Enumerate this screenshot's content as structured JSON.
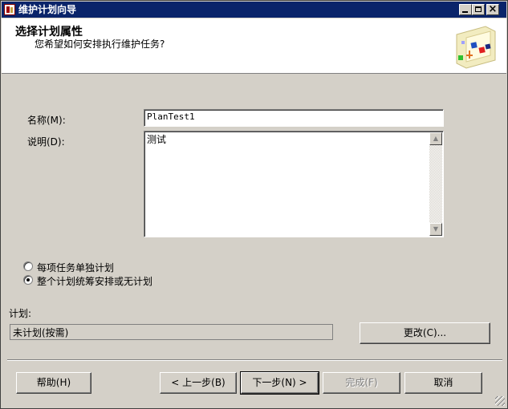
{
  "window": {
    "title": "维护计划向导"
  },
  "header": {
    "title": "选择计划属性",
    "subtitle": "您希望如何安排执行维护任务?"
  },
  "form": {
    "name_label": "名称(M):",
    "name_value": "PlanTest1",
    "desc_label": "说明(D):",
    "desc_value": "测试"
  },
  "schedule_options": {
    "option_separate": "每项任务单独计划",
    "option_single": "整个计划统筹安排或无计划",
    "selected": "option_single"
  },
  "schedule": {
    "label": "计划:",
    "value": "未计划(按需)",
    "change_button": "更改(C)..."
  },
  "footer": {
    "help": "帮助(H)",
    "back": "< 上一步(B)",
    "next": "下一步(N) >",
    "finish": "完成(F)",
    "cancel": "取消"
  },
  "icons": {
    "app": "wizard-app-icon",
    "header_art": "maintenance-plan-wizard-icon",
    "minimize": "minimize-icon",
    "maximize": "maximize-icon",
    "close": "close-icon",
    "scroll_up": "scroll-up-arrow-icon",
    "scroll_down": "scroll-down-arrow-icon",
    "size_grip": "resize-grip-icon"
  },
  "colors": {
    "titlebar": "#0a246a",
    "face": "#d4d0c8",
    "header_bg": "#ffffff"
  }
}
